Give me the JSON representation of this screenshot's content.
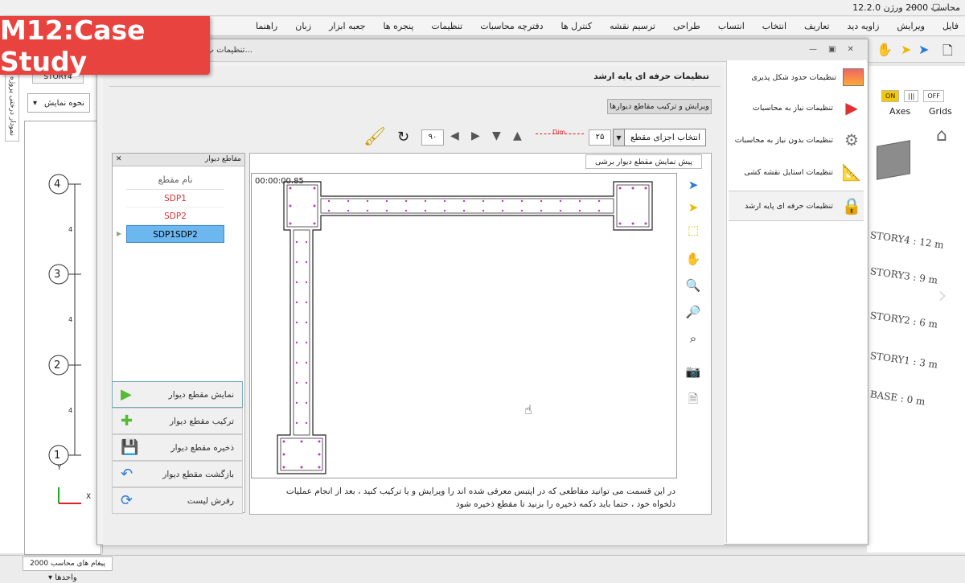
{
  "app": {
    "title": "محاسب 2000 ورژن 12.2.0",
    "logo": "M"
  },
  "badge": {
    "label": "M12:Case Study"
  },
  "menu": [
    "فایل",
    "ویرایش",
    "زاویه دید",
    "تعاریف",
    "انتخاب",
    "انتساب",
    "طراحی",
    "ترسیم نقشه",
    "کنترل ها",
    "دفترچه محاسبات",
    "تنظیمات",
    "پنجره ها",
    "جعبه ابزار",
    "زبان",
    "راهنما"
  ],
  "dialog": {
    "title": "تنظیمات پ..."
  },
  "left": {
    "vtab": "نمودار درختی پروژه",
    "storytab": "STORY4",
    "view_select": "نحوه نمایش"
  },
  "sidebar": {
    "items": [
      {
        "label": "تنظیمات حدود شکل پذیری",
        "icon": "chart-icon"
      },
      {
        "label": "تنظیمات نیاز به محاسبات",
        "icon": "play-icon"
      },
      {
        "label": "تنظیمات بدون نیاز به محاسبات",
        "icon": "gears-icon"
      },
      {
        "label": "تنظیمات استایل نقشه کشی",
        "icon": "ruler-icon"
      },
      {
        "label": "تنظیمات حرفه ای پایه ارشد",
        "icon": "lock-icon"
      }
    ]
  },
  "content": {
    "header": "تنظیمات حرفه ای پایه ارشد",
    "tab": "ویرایش و ترکیب مقاطع دیوارها",
    "combo": "انتخاب اجزای مقطع",
    "dim_label": "Dim",
    "dim_value": "۲۵",
    "rotate_value": "۹۰",
    "list_title": "مقاطع دیوار",
    "list_col": "نام مقطع",
    "rows": [
      "SDP1",
      "SDP2",
      "SDP1SDP2"
    ],
    "buttons": [
      "نمایش مقطع دیوار",
      "ترکیب مقطع دیوار",
      "ذخیره مقطع دیوار",
      "بازگشت مقطع دیوار",
      "رفرش لیست"
    ],
    "preview_tab": "پیش نمایش مقطع دیوار برشی",
    "timer": "00:00:00.85",
    "description": "در این قسمت می توانید مقاطعی که در اپتبس معرفی شده اند را ویرایش و یا ترکیب کنید ، بعد از انجام عملیات دلخواه خود ، حتما باید دکمه ذخیره را بزنید تا مقطع ذخیره شود"
  },
  "grid": {
    "labels": [
      "4",
      "3",
      "2",
      "1"
    ],
    "dims": [
      "4",
      "4",
      "4"
    ],
    "axis_y": "Y",
    "axis_x": "X"
  },
  "right": {
    "on": "ON",
    "off": "OFF",
    "axes": "Axes",
    "grids": "Grids",
    "stories": [
      "STORY4 : 12 m",
      "STORY3 : 9 m",
      "STORY2 : 6 m",
      "STORY1 : 3 m",
      "BASE : 0 m"
    ]
  },
  "status": {
    "messages_tab": "پیغام های محاسب 2000",
    "units": "واحدها"
  }
}
